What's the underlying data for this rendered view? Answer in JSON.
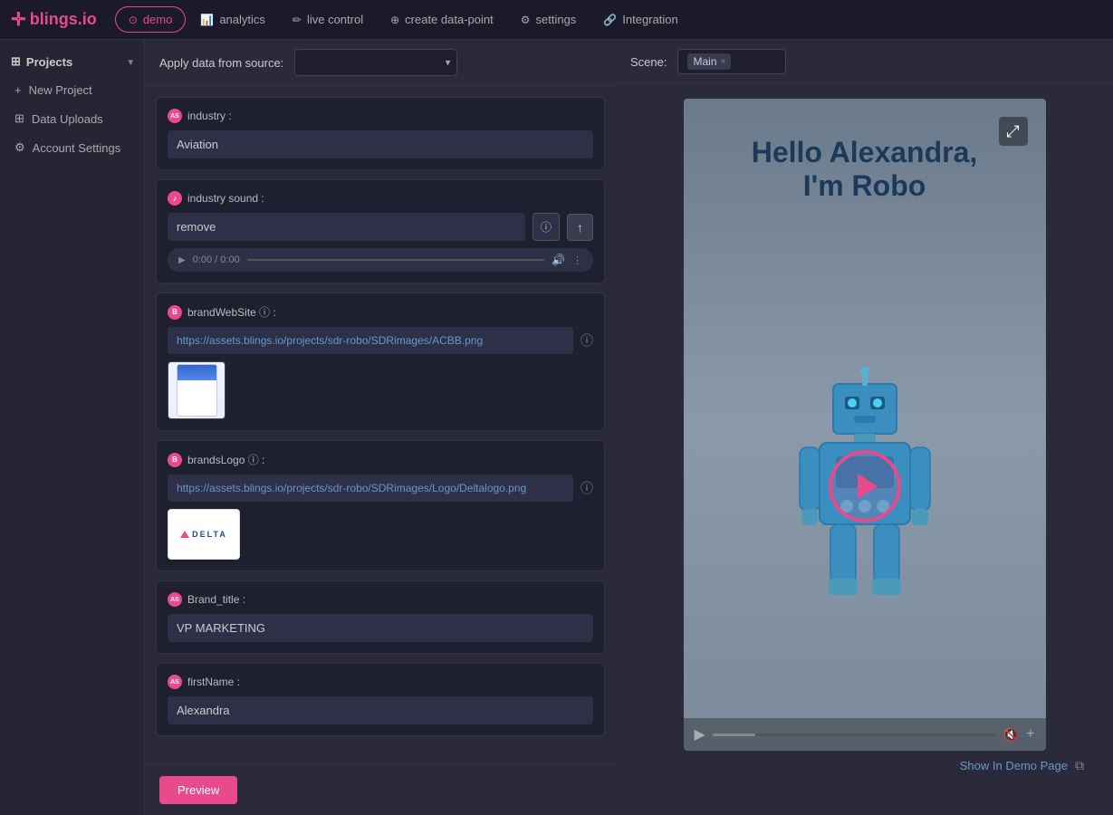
{
  "logo": {
    "symbol": "✛",
    "text": "blings.io"
  },
  "nav": {
    "tabs": [
      {
        "id": "demo",
        "label": "demo",
        "icon": "⊙",
        "active": true
      },
      {
        "id": "analytics",
        "label": "analytics",
        "icon": "📊",
        "active": false
      },
      {
        "id": "live-control",
        "label": "live control",
        "icon": "✏",
        "active": false
      },
      {
        "id": "create-data-point",
        "label": "create data-point",
        "icon": "⊕",
        "active": false
      },
      {
        "id": "settings",
        "label": "settings",
        "icon": "⚙",
        "active": false
      },
      {
        "id": "integration",
        "label": "Integration",
        "icon": "🔗",
        "active": false
      }
    ]
  },
  "sidebar": {
    "projects_label": "Projects",
    "chevron": "▾",
    "items": [
      {
        "id": "new-project",
        "label": "New Project",
        "icon": "+"
      },
      {
        "id": "data-uploads",
        "label": "Data Uploads",
        "icon": "⊞"
      },
      {
        "id": "account-settings",
        "label": "Account Settings",
        "icon": "⚙"
      }
    ]
  },
  "apply_data": {
    "label": "Apply data from source:",
    "placeholder": "",
    "options": []
  },
  "scene": {
    "label": "Scene:",
    "tag": "Main",
    "close": "×"
  },
  "fields": [
    {
      "id": "industry",
      "label": "industry :",
      "type": "text",
      "value": "Aviation",
      "icon_letter": "AS"
    },
    {
      "id": "industry-sound",
      "label": "industry sound :",
      "type": "sound",
      "value": "remove",
      "time": "0:00 / 0:00",
      "icon_letter": "🎵"
    },
    {
      "id": "brandWebSite",
      "label": "brandWebSite ⓘ :",
      "type": "url-image",
      "value": "https://assets.blings.io/projects/sdr-robo/SDRimages/ACBB.png",
      "icon_letter": "B"
    },
    {
      "id": "brandsLogo",
      "label": "brandsLogo ⓘ :",
      "type": "url-image-delta",
      "value": "https://assets.blings.io/projects/sdr-robo/SDRimages/Logo/Deltalogo.png",
      "icon_letter": "B"
    },
    {
      "id": "brand-title",
      "label": "Brand_title :",
      "type": "text",
      "value": "VP MARKETING",
      "icon_letter": "AS"
    },
    {
      "id": "firstName",
      "label": "firstName :",
      "type": "text",
      "value": "Alexandra",
      "icon_letter": "AS"
    }
  ],
  "preview_button": {
    "label": "Preview"
  },
  "preview": {
    "hello_text": "Hello Alexandra,",
    "robo_text": "I'm Robo",
    "show_demo_label": "Show In Demo Page"
  },
  "expand_icon": "⤢"
}
